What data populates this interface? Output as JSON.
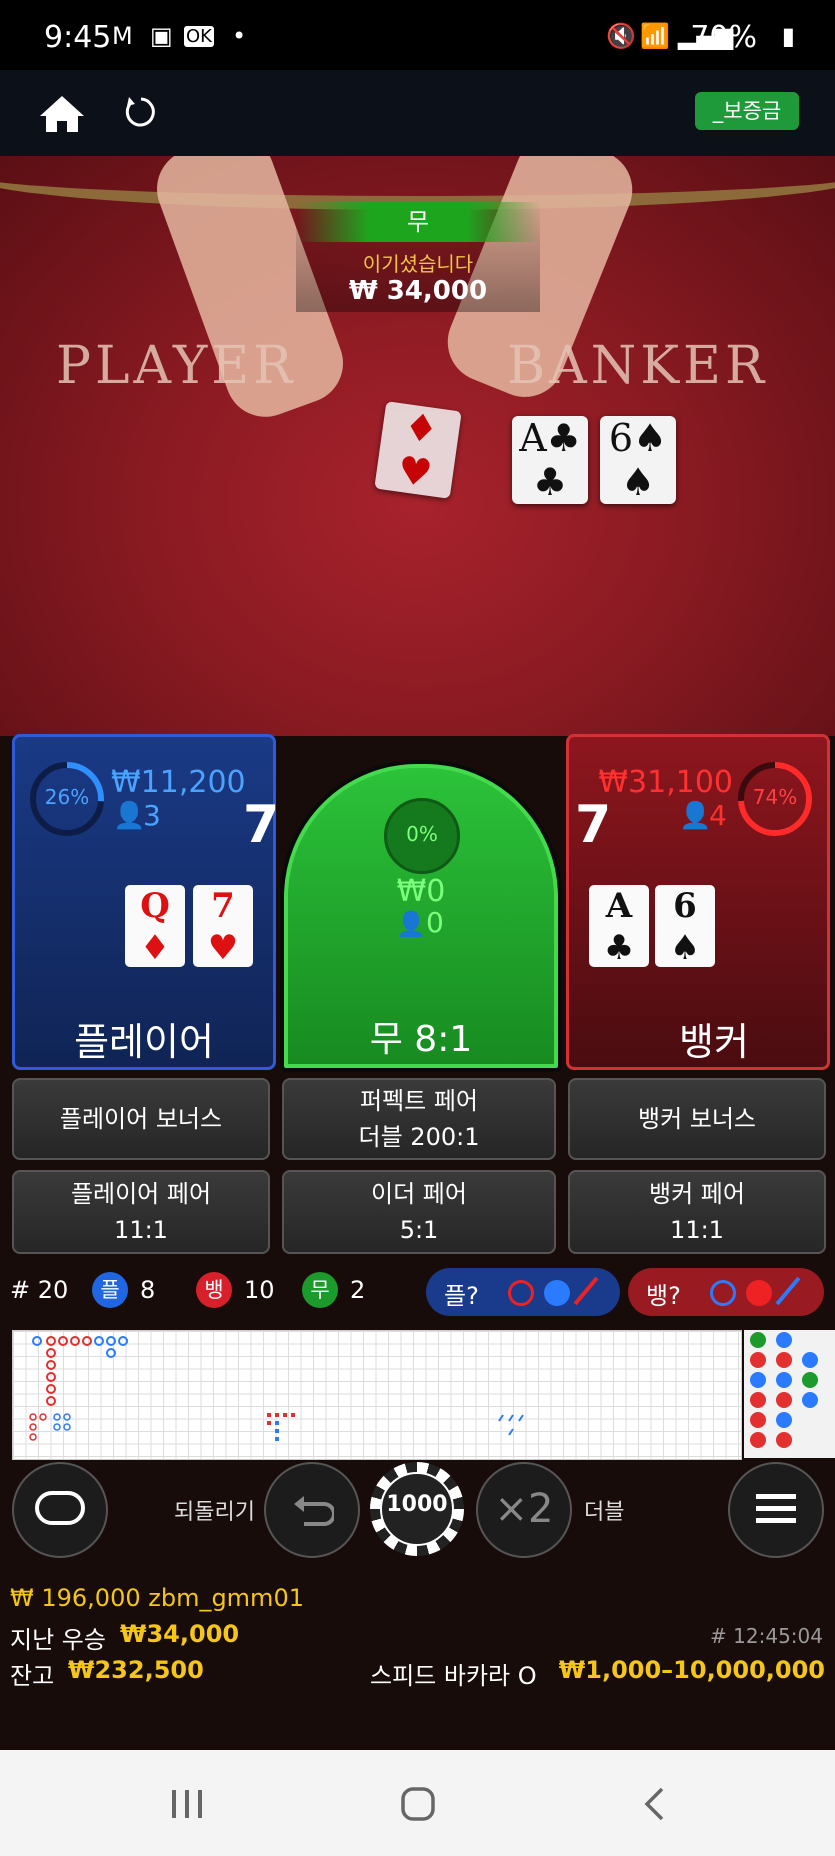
{
  "status_bar": {
    "time": "9:45",
    "battery": "70%"
  },
  "top_bar": {
    "deposit_label": "_보증금"
  },
  "video": {
    "table_text_player": "PLAYER",
    "table_text_banker": "BANKER",
    "result_label": "무",
    "result_message": "이기셨습니다",
    "result_amount": "₩ 34,000",
    "banker_cards": [
      "A♣",
      "6♠"
    ]
  },
  "player": {
    "percent": "26%",
    "amount": "₩11,200",
    "bettors": "3",
    "score": "7",
    "cards": [
      {
        "rank": "Q",
        "suit": "♦"
      },
      {
        "rank": "7",
        "suit": "♥"
      }
    ],
    "label": "플레이어"
  },
  "tie": {
    "percent": "0%",
    "amount": "₩0",
    "bettors": "0",
    "label": "무 8:1"
  },
  "banker": {
    "percent": "74%",
    "amount": "₩31,100",
    "bettors": "4",
    "score": "7",
    "cards": [
      {
        "rank": "A",
        "suit": "♣"
      },
      {
        "rank": "6",
        "suit": "♠"
      }
    ],
    "label": "뱅커"
  },
  "side_bets": {
    "player_bonus": "플레이어 보너스",
    "perfect_pair": "퍼펙트 페어",
    "perfect_pair_odds": "더블 200:1",
    "banker_bonus": "뱅커 보너스",
    "player_pair": "플레이어 페어",
    "player_pair_odds": "11:1",
    "either_pair": "이더 페어",
    "either_pair_odds": "5:1",
    "banker_pair": "뱅커 페어",
    "banker_pair_odds": "11:1"
  },
  "stats": {
    "round": "# 20",
    "player_label": "플",
    "player_count": "8",
    "banker_label": "뱅",
    "banker_count": "10",
    "tie_label": "무",
    "tie_count": "2",
    "player_predict": "플?",
    "banker_predict": "뱅?"
  },
  "controls": {
    "undo_label": "되돌리기",
    "chip_value": "1000",
    "double_symbol": "×2",
    "double_label": "더블"
  },
  "footer": {
    "balance_user": "₩ 196,000 zbm_gmm01",
    "last_win_label": "지난 우승",
    "last_win_amount": "₩34,000",
    "balance_label": "잔고",
    "balance_amount": "₩232,500",
    "round_time": "# 12:45:04",
    "table_name": "스피드 바카라 O",
    "limits": "₩1,000–10,000,000"
  },
  "colors": {
    "player": "#2f5bd8",
    "banker": "#d53035",
    "tie": "#1ea51e",
    "gold": "#f5c518"
  }
}
